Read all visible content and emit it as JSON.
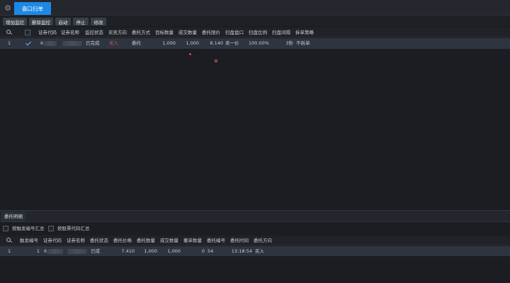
{
  "top_tab": "盘口扫单",
  "toolbar": {
    "buttons": [
      "增加监控",
      "删除监控",
      "启动",
      "停止",
      "修改"
    ]
  },
  "main_grid": {
    "headers": [
      "证券代码",
      "证券名称",
      "监控状态",
      "买卖方向",
      "委托方式",
      "目标数量",
      "成交数量",
      "委托限价",
      "扫盘盘口",
      "扫盘比例",
      "扫盘间隔",
      "拆单策略"
    ],
    "row": {
      "index": "1",
      "code_prefix": "6",
      "status": "已完成",
      "direction": "买入",
      "method": "委托",
      "target_qty": "1,000",
      "filled_qty": "1,000",
      "limit_price": "8.140",
      "level": "卖一价",
      "ratio": "100.00%",
      "interval": "3秒",
      "split": "不拆单"
    }
  },
  "bottom_panel": {
    "tab": "委托明细",
    "filters": [
      "按触发编号汇总",
      "按股票代码汇总"
    ],
    "headers": [
      "触发编号",
      "证券代码",
      "证券名称",
      "委托状态",
      "委托价格",
      "委托数量",
      "成交数量",
      "撤单数量",
      "委托编号",
      "委托时间",
      "委托方向"
    ],
    "row": {
      "index": "1",
      "trigger_no": "1",
      "code_prefix": "6",
      "status": "已成",
      "price": "7.410",
      "qty": "1,000",
      "filled": "1,000",
      "cancelled": "0",
      "order_no": "54",
      "time": "13:18:54",
      "direction": "买入"
    }
  },
  "colors": {
    "accent": "#1e88e5",
    "buy_red": "#e05252",
    "row_selected": "#2e3540"
  }
}
